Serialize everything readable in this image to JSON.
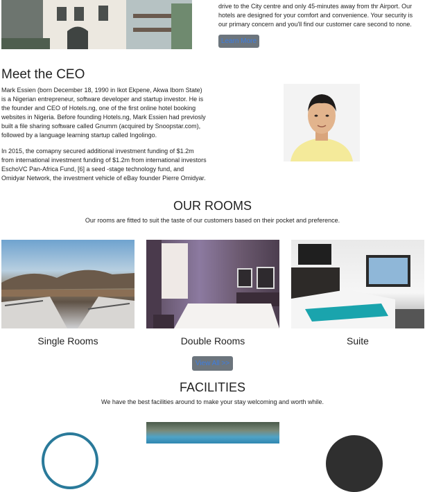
{
  "about": {
    "text": "drive to the City centre and only 45-minutes away from thr Airport. Our hotels are designed for your comfort and convenience. Your security is our primary concern and you'll find our customer care second to none.",
    "learn_more": "Learn More"
  },
  "ceo": {
    "title": "Meet the CEO",
    "para1": "Mark Essien (born December 18, 1990 in Ikot Ekpene, Akwa Ibom State) is a Nigerian entrepreneur, software developer and startup investor. He is the founder and CEO of Hotels.ng, one of the first online hotel booking websites in Nigeria. Before founding Hotels.ng, Mark Essien had previosly built a file sharing software called Gnumm (acquired by Snoopstar.com), followed by a language learning startup called Ingolingo.",
    "para2": "In 2015, the comapny secured additional investment funding of $1.2m from international investment funding of $1.2m from international investors EschoVC Pan-Africa Fund, [6] a seed -stage technology fund, and Omidyar Network, the investment vehicle of eBay founder Pierre Omidyar."
  },
  "rooms": {
    "title": "OUR ROOMS",
    "subtitle": "Our rooms are fitted to suit the taste of our customers based on their pocket and preference.",
    "items": [
      {
        "label": "Single Rooms"
      },
      {
        "label": "Double Rooms"
      },
      {
        "label": "Suite"
      }
    ],
    "view_all": "View All >>"
  },
  "facilities": {
    "title": "FACILITIES",
    "subtitle": "We have the best facilities around to make your stay welcoming and worth while."
  }
}
